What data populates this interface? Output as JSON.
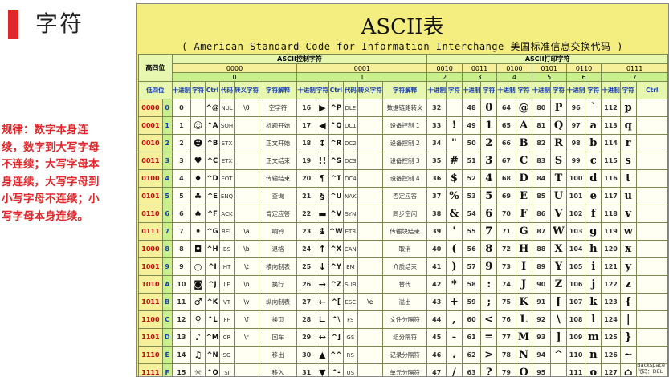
{
  "page": {
    "title": "字符",
    "rule_text": "规律：数字本身连续，数字到大写字母不连续；大写字母本身连续，大写字母到小写字母不连续；小写字母本身连续。"
  },
  "ascii_table": {
    "title": "ASCII表",
    "subtitle": "( American Standard Code for Information Interchange  美国标准信息交换代码 )",
    "high_label": "高四位",
    "low_label": "低四位",
    "control_group_label": "ASCII控制字符",
    "printable_group_label": "ASCII打印字符",
    "high_bits": [
      "0000",
      "0001",
      "0010",
      "0011",
      "0100",
      "0101",
      "0110",
      "0111"
    ],
    "high_hex": [
      "0",
      "1",
      "2",
      "3",
      "4",
      "5",
      "6",
      "7"
    ],
    "col_headers": {
      "dec": "十进制",
      "char": "字符",
      "ctrl": "Ctrl",
      "code": "代码",
      "escape": "转义字符",
      "meaning": "字符解释"
    },
    "rows": [
      {
        "bin": "0000",
        "hex": "0",
        "c0": {
          "dec": "0",
          "ch": "",
          "ctrl": "^@",
          "code": "NUL",
          "esc": "\\0",
          "name": "空字符"
        },
        "c1": {
          "dec": "16",
          "ch": "▶",
          "ctrl": "^P",
          "code": "DLE",
          "esc": "",
          "name": "数据链路转义"
        },
        "p": [
          {
            "d": "32",
            "c": ""
          },
          {
            "d": "48",
            "c": "0"
          },
          {
            "d": "64",
            "c": "@"
          },
          {
            "d": "80",
            "c": "P"
          },
          {
            "d": "96",
            "c": "`"
          },
          {
            "d": "112",
            "c": "p"
          }
        ]
      },
      {
        "bin": "0001",
        "hex": "1",
        "c0": {
          "dec": "1",
          "ch": "☺",
          "ctrl": "^A",
          "code": "SOH",
          "esc": "",
          "name": "标题开始"
        },
        "c1": {
          "dec": "17",
          "ch": "◀",
          "ctrl": "^Q",
          "code": "DC1",
          "esc": "",
          "name": "设备控制 1"
        },
        "p": [
          {
            "d": "33",
            "c": "!"
          },
          {
            "d": "49",
            "c": "1"
          },
          {
            "d": "65",
            "c": "A"
          },
          {
            "d": "81",
            "c": "Q"
          },
          {
            "d": "97",
            "c": "a"
          },
          {
            "d": "113",
            "c": "q"
          }
        ]
      },
      {
        "bin": "0010",
        "hex": "2",
        "c0": {
          "dec": "2",
          "ch": "☻",
          "ctrl": "^B",
          "code": "STX",
          "esc": "",
          "name": "正文开始"
        },
        "c1": {
          "dec": "18",
          "ch": "↕",
          "ctrl": "^R",
          "code": "DC2",
          "esc": "",
          "name": "设备控制 2"
        },
        "p": [
          {
            "d": "34",
            "c": "\""
          },
          {
            "d": "50",
            "c": "2"
          },
          {
            "d": "66",
            "c": "B"
          },
          {
            "d": "82",
            "c": "R"
          },
          {
            "d": "98",
            "c": "b"
          },
          {
            "d": "114",
            "c": "r"
          }
        ]
      },
      {
        "bin": "0011",
        "hex": "3",
        "c0": {
          "dec": "3",
          "ch": "♥",
          "ctrl": "^C",
          "code": "ETX",
          "esc": "",
          "name": "正文结束"
        },
        "c1": {
          "dec": "19",
          "ch": "!!",
          "ctrl": "^S",
          "code": "DC3",
          "esc": "",
          "name": "设备控制 3"
        },
        "p": [
          {
            "d": "35",
            "c": "#"
          },
          {
            "d": "51",
            "c": "3"
          },
          {
            "d": "67",
            "c": "C"
          },
          {
            "d": "83",
            "c": "S"
          },
          {
            "d": "99",
            "c": "c"
          },
          {
            "d": "115",
            "c": "s"
          }
        ]
      },
      {
        "bin": "0100",
        "hex": "4",
        "c0": {
          "dec": "4",
          "ch": "♦",
          "ctrl": "^D",
          "code": "EOT",
          "esc": "",
          "name": "传输结束"
        },
        "c1": {
          "dec": "20",
          "ch": "¶",
          "ctrl": "^T",
          "code": "DC4",
          "esc": "",
          "name": "设备控制 4"
        },
        "p": [
          {
            "d": "36",
            "c": "$"
          },
          {
            "d": "52",
            "c": "4"
          },
          {
            "d": "68",
            "c": "D"
          },
          {
            "d": "84",
            "c": "T"
          },
          {
            "d": "100",
            "c": "d"
          },
          {
            "d": "116",
            "c": "t"
          }
        ]
      },
      {
        "bin": "0101",
        "hex": "5",
        "c0": {
          "dec": "5",
          "ch": "♣",
          "ctrl": "^E",
          "code": "ENQ",
          "esc": "",
          "name": "查询"
        },
        "c1": {
          "dec": "21",
          "ch": "§",
          "ctrl": "^U",
          "code": "NAK",
          "esc": "",
          "name": "否定应答"
        },
        "p": [
          {
            "d": "37",
            "c": "%"
          },
          {
            "d": "53",
            "c": "5"
          },
          {
            "d": "69",
            "c": "E"
          },
          {
            "d": "85",
            "c": "U"
          },
          {
            "d": "101",
            "c": "e"
          },
          {
            "d": "117",
            "c": "u"
          }
        ]
      },
      {
        "bin": "0110",
        "hex": "6",
        "c0": {
          "dec": "6",
          "ch": "♠",
          "ctrl": "^F",
          "code": "ACK",
          "esc": "",
          "name": "肯定应答"
        },
        "c1": {
          "dec": "22",
          "ch": "▬",
          "ctrl": "^V",
          "code": "SYN",
          "esc": "",
          "name": "同步空闲"
        },
        "p": [
          {
            "d": "38",
            "c": "&"
          },
          {
            "d": "54",
            "c": "6"
          },
          {
            "d": "70",
            "c": "F"
          },
          {
            "d": "86",
            "c": "V"
          },
          {
            "d": "102",
            "c": "f"
          },
          {
            "d": "118",
            "c": "v"
          }
        ]
      },
      {
        "bin": "0111",
        "hex": "7",
        "c0": {
          "dec": "7",
          "ch": "•",
          "ctrl": "^G",
          "code": "BEL",
          "esc": "\\a",
          "name": "响铃"
        },
        "c1": {
          "dec": "23",
          "ch": "↨",
          "ctrl": "^W",
          "code": "ETB",
          "esc": "",
          "name": "传输块结束"
        },
        "p": [
          {
            "d": "39",
            "c": "'"
          },
          {
            "d": "55",
            "c": "7"
          },
          {
            "d": "71",
            "c": "G"
          },
          {
            "d": "87",
            "c": "W"
          },
          {
            "d": "103",
            "c": "g"
          },
          {
            "d": "119",
            "c": "w"
          }
        ]
      },
      {
        "bin": "1000",
        "hex": "8",
        "c0": {
          "dec": "8",
          "ch": "◘",
          "ctrl": "^H",
          "code": "BS",
          "esc": "\\b",
          "name": "退格"
        },
        "c1": {
          "dec": "24",
          "ch": "↑",
          "ctrl": "^X",
          "code": "CAN",
          "esc": "",
          "name": "取消"
        },
        "p": [
          {
            "d": "40",
            "c": "("
          },
          {
            "d": "56",
            "c": "8"
          },
          {
            "d": "72",
            "c": "H"
          },
          {
            "d": "88",
            "c": "X"
          },
          {
            "d": "104",
            "c": "h"
          },
          {
            "d": "120",
            "c": "x"
          }
        ]
      },
      {
        "bin": "1001",
        "hex": "9",
        "c0": {
          "dec": "9",
          "ch": "○",
          "ctrl": "^I",
          "code": "HT",
          "esc": "\\t",
          "name": "横向制表"
        },
        "c1": {
          "dec": "25",
          "ch": "↓",
          "ctrl": "^Y",
          "code": "EM",
          "esc": "",
          "name": "介质结束"
        },
        "p": [
          {
            "d": "41",
            "c": ")"
          },
          {
            "d": "57",
            "c": "9"
          },
          {
            "d": "73",
            "c": "I"
          },
          {
            "d": "89",
            "c": "Y"
          },
          {
            "d": "105",
            "c": "i"
          },
          {
            "d": "121",
            "c": "y"
          }
        ]
      },
      {
        "bin": "1010",
        "hex": "A",
        "c0": {
          "dec": "10",
          "ch": "◙",
          "ctrl": "^J",
          "code": "LF",
          "esc": "\\n",
          "name": "换行"
        },
        "c1": {
          "dec": "26",
          "ch": "→",
          "ctrl": "^Z",
          "code": "SUB",
          "esc": "",
          "name": "替代"
        },
        "p": [
          {
            "d": "42",
            "c": "*"
          },
          {
            "d": "58",
            "c": ":"
          },
          {
            "d": "74",
            "c": "J"
          },
          {
            "d": "90",
            "c": "Z"
          },
          {
            "d": "106",
            "c": "j"
          },
          {
            "d": "122",
            "c": "z"
          }
        ]
      },
      {
        "bin": "1011",
        "hex": "B",
        "c0": {
          "dec": "11",
          "ch": "♂",
          "ctrl": "^K",
          "code": "VT",
          "esc": "\\v",
          "name": "纵向制表"
        },
        "c1": {
          "dec": "27",
          "ch": "←",
          "ctrl": "^[",
          "code": "ESC",
          "esc": "\\e",
          "name": "溢出"
        },
        "p": [
          {
            "d": "43",
            "c": "+"
          },
          {
            "d": "59",
            "c": ";"
          },
          {
            "d": "75",
            "c": "K"
          },
          {
            "d": "91",
            "c": "["
          },
          {
            "d": "107",
            "c": "k"
          },
          {
            "d": "123",
            "c": "{"
          }
        ]
      },
      {
        "bin": "1100",
        "hex": "C",
        "c0": {
          "dec": "12",
          "ch": "♀",
          "ctrl": "^L",
          "code": "FF",
          "esc": "\\f",
          "name": "换页"
        },
        "c1": {
          "dec": "28",
          "ch": "∟",
          "ctrl": "^\\",
          "code": "FS",
          "esc": "",
          "name": "文件分隔符"
        },
        "p": [
          {
            "d": "44",
            "c": ","
          },
          {
            "d": "60",
            "c": "<"
          },
          {
            "d": "76",
            "c": "L"
          },
          {
            "d": "92",
            "c": "\\"
          },
          {
            "d": "108",
            "c": "l"
          },
          {
            "d": "124",
            "c": "|"
          }
        ]
      },
      {
        "bin": "1101",
        "hex": "D",
        "c0": {
          "dec": "13",
          "ch": "♪",
          "ctrl": "^M",
          "code": "CR",
          "esc": "\\r",
          "name": "回车"
        },
        "c1": {
          "dec": "29",
          "ch": "↔",
          "ctrl": "^]",
          "code": "GS",
          "esc": "",
          "name": "组分隔符"
        },
        "p": [
          {
            "d": "45",
            "c": "-"
          },
          {
            "d": "61",
            "c": "="
          },
          {
            "d": "77",
            "c": "M"
          },
          {
            "d": "93",
            "c": "]"
          },
          {
            "d": "109",
            "c": "m"
          },
          {
            "d": "125",
            "c": "}"
          }
        ]
      },
      {
        "bin": "1110",
        "hex": "E",
        "c0": {
          "dec": "14",
          "ch": "♫",
          "ctrl": "^N",
          "code": "SO",
          "esc": "",
          "name": "移出"
        },
        "c1": {
          "dec": "30",
          "ch": "▲",
          "ctrl": "^^",
          "code": "RS",
          "esc": "",
          "name": "记录分隔符"
        },
        "p": [
          {
            "d": "46",
            "c": "."
          },
          {
            "d": "62",
            "c": ">"
          },
          {
            "d": "78",
            "c": "N"
          },
          {
            "d": "94",
            "c": "^"
          },
          {
            "d": "110",
            "c": "n"
          },
          {
            "d": "126",
            "c": "~"
          }
        ]
      },
      {
        "bin": "1111",
        "hex": "F",
        "c0": {
          "dec": "15",
          "ch": "☼",
          "ctrl": "^O",
          "code": "SI",
          "esc": "",
          "name": "移入"
        },
        "c1": {
          "dec": "31",
          "ch": "▼",
          "ctrl": "^-",
          "code": "US",
          "esc": "",
          "name": "单元分隔符"
        },
        "p": [
          {
            "d": "47",
            "c": "/"
          },
          {
            "d": "63",
            "c": "?"
          },
          {
            "d": "79",
            "c": "O"
          },
          {
            "d": "95",
            "c": "_"
          },
          {
            "d": "111",
            "c": "o"
          },
          {
            "d": "127",
            "c": "⌂"
          }
        ]
      }
    ],
    "last_cell_note": "Backspace",
    "bottom_note": "代码：DEL"
  }
}
